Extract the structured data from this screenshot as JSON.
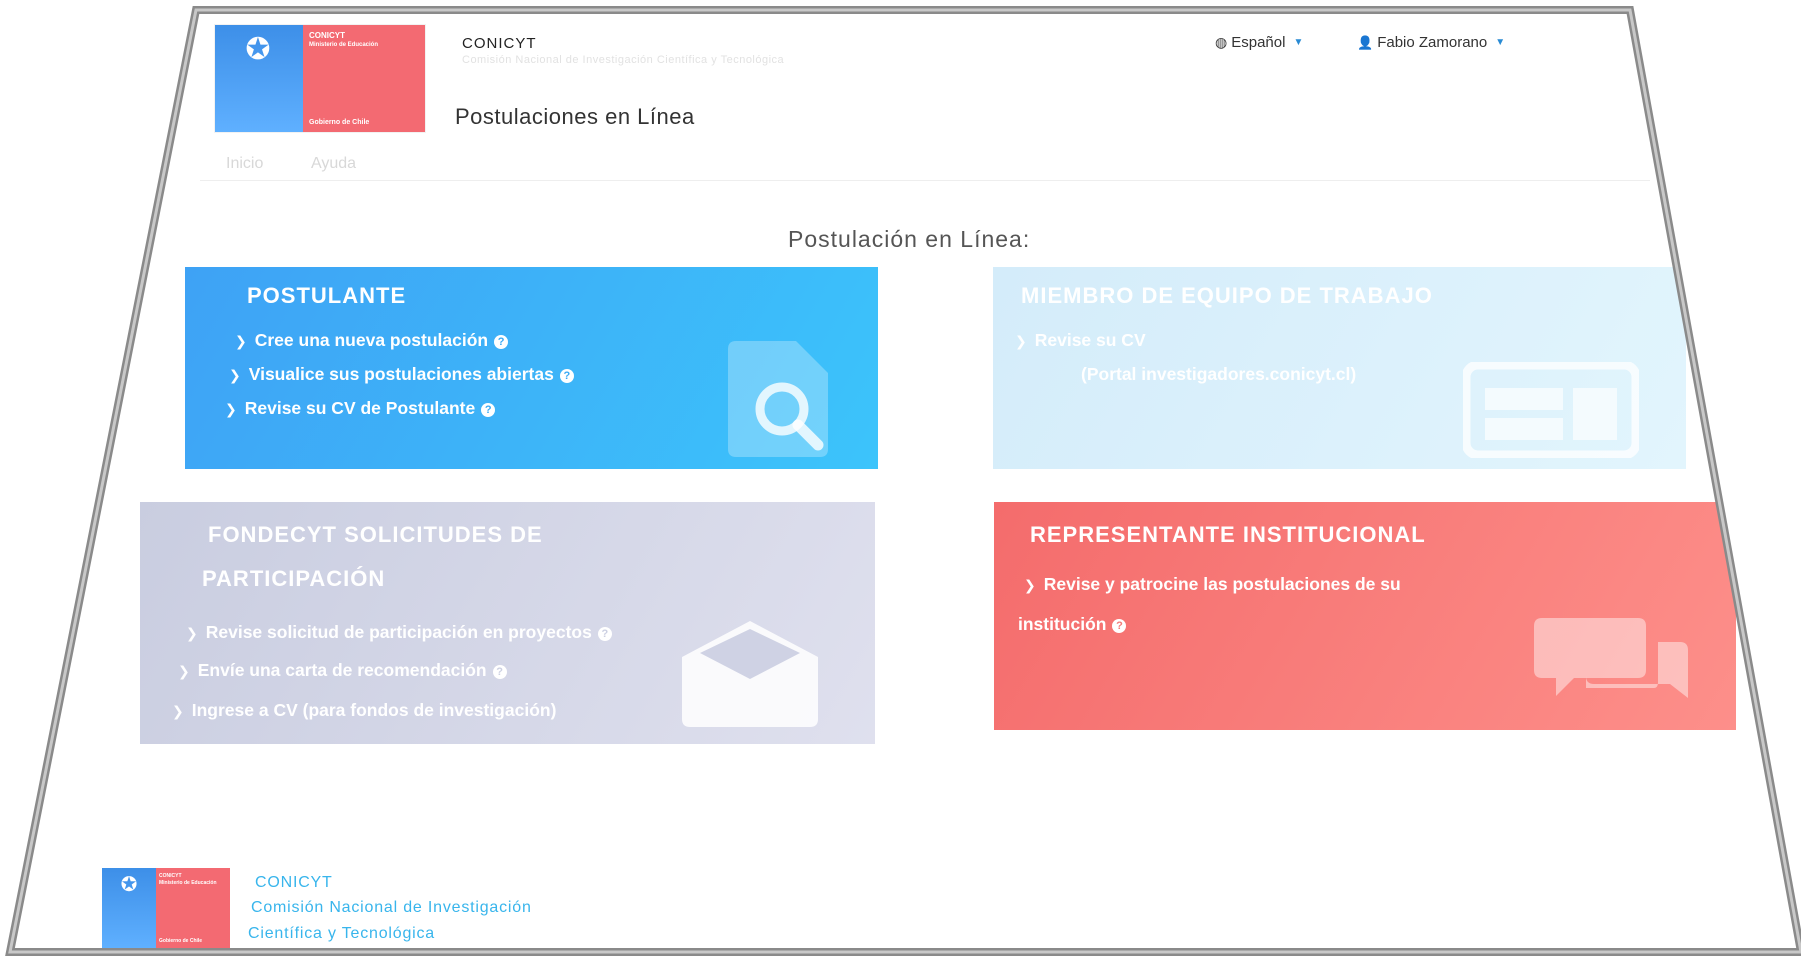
{
  "header": {
    "logo": {
      "line1": "CONICYT",
      "line2": "Ministerio de Educación",
      "line3": "Gobierno de Chile"
    },
    "brand": "CONICYT",
    "brand_subtitle": "Comisión Nacional de Investigación Científica y Tecnológica",
    "site_title": "Postulaciones en Línea",
    "language": "Español",
    "user": "Fabio Zamorano"
  },
  "menu": {
    "inicio": "Inicio",
    "ayuda": "Ayuda"
  },
  "main": {
    "section_title": "Postulación en Línea:",
    "cards": {
      "postulante": {
        "title": "POSTULANTE",
        "items": [
          "Cree una nueva postulación",
          "Visualice sus postulaciones abiertas",
          "Revise su CV de Postulante"
        ]
      },
      "miembro": {
        "title": "MIEMBRO DE EQUIPO DE TRABAJO",
        "items": [
          "Revise su CV",
          "(Portal investigadores.conicyt.cl)"
        ]
      },
      "fondecyt": {
        "title_line1": "FONDECYT SOLICITUDES DE",
        "title_line2": "PARTICIPACIÓN",
        "items": [
          "Revise solicitud de participación en proyectos",
          "Envíe una carta de recomendación",
          "Ingrese a CV (para fondos de investigación)"
        ]
      },
      "representante": {
        "title": "REPRESENTANTE INSTITUCIONAL",
        "item_line1": "Revise y patrocine las postulaciones de su",
        "item_line2": "institución"
      }
    }
  },
  "footer": {
    "line1": "CONICYT",
    "line2": "Comisión Nacional de Investigación",
    "line3": "Científica y Tecnológica"
  },
  "colors": {
    "postulante": "#3ea2f5",
    "miembro": "#d4ecfa",
    "fondecyt": "#c9cde0",
    "representante": "#f46c6c",
    "footer_text": "#38b5ec"
  }
}
